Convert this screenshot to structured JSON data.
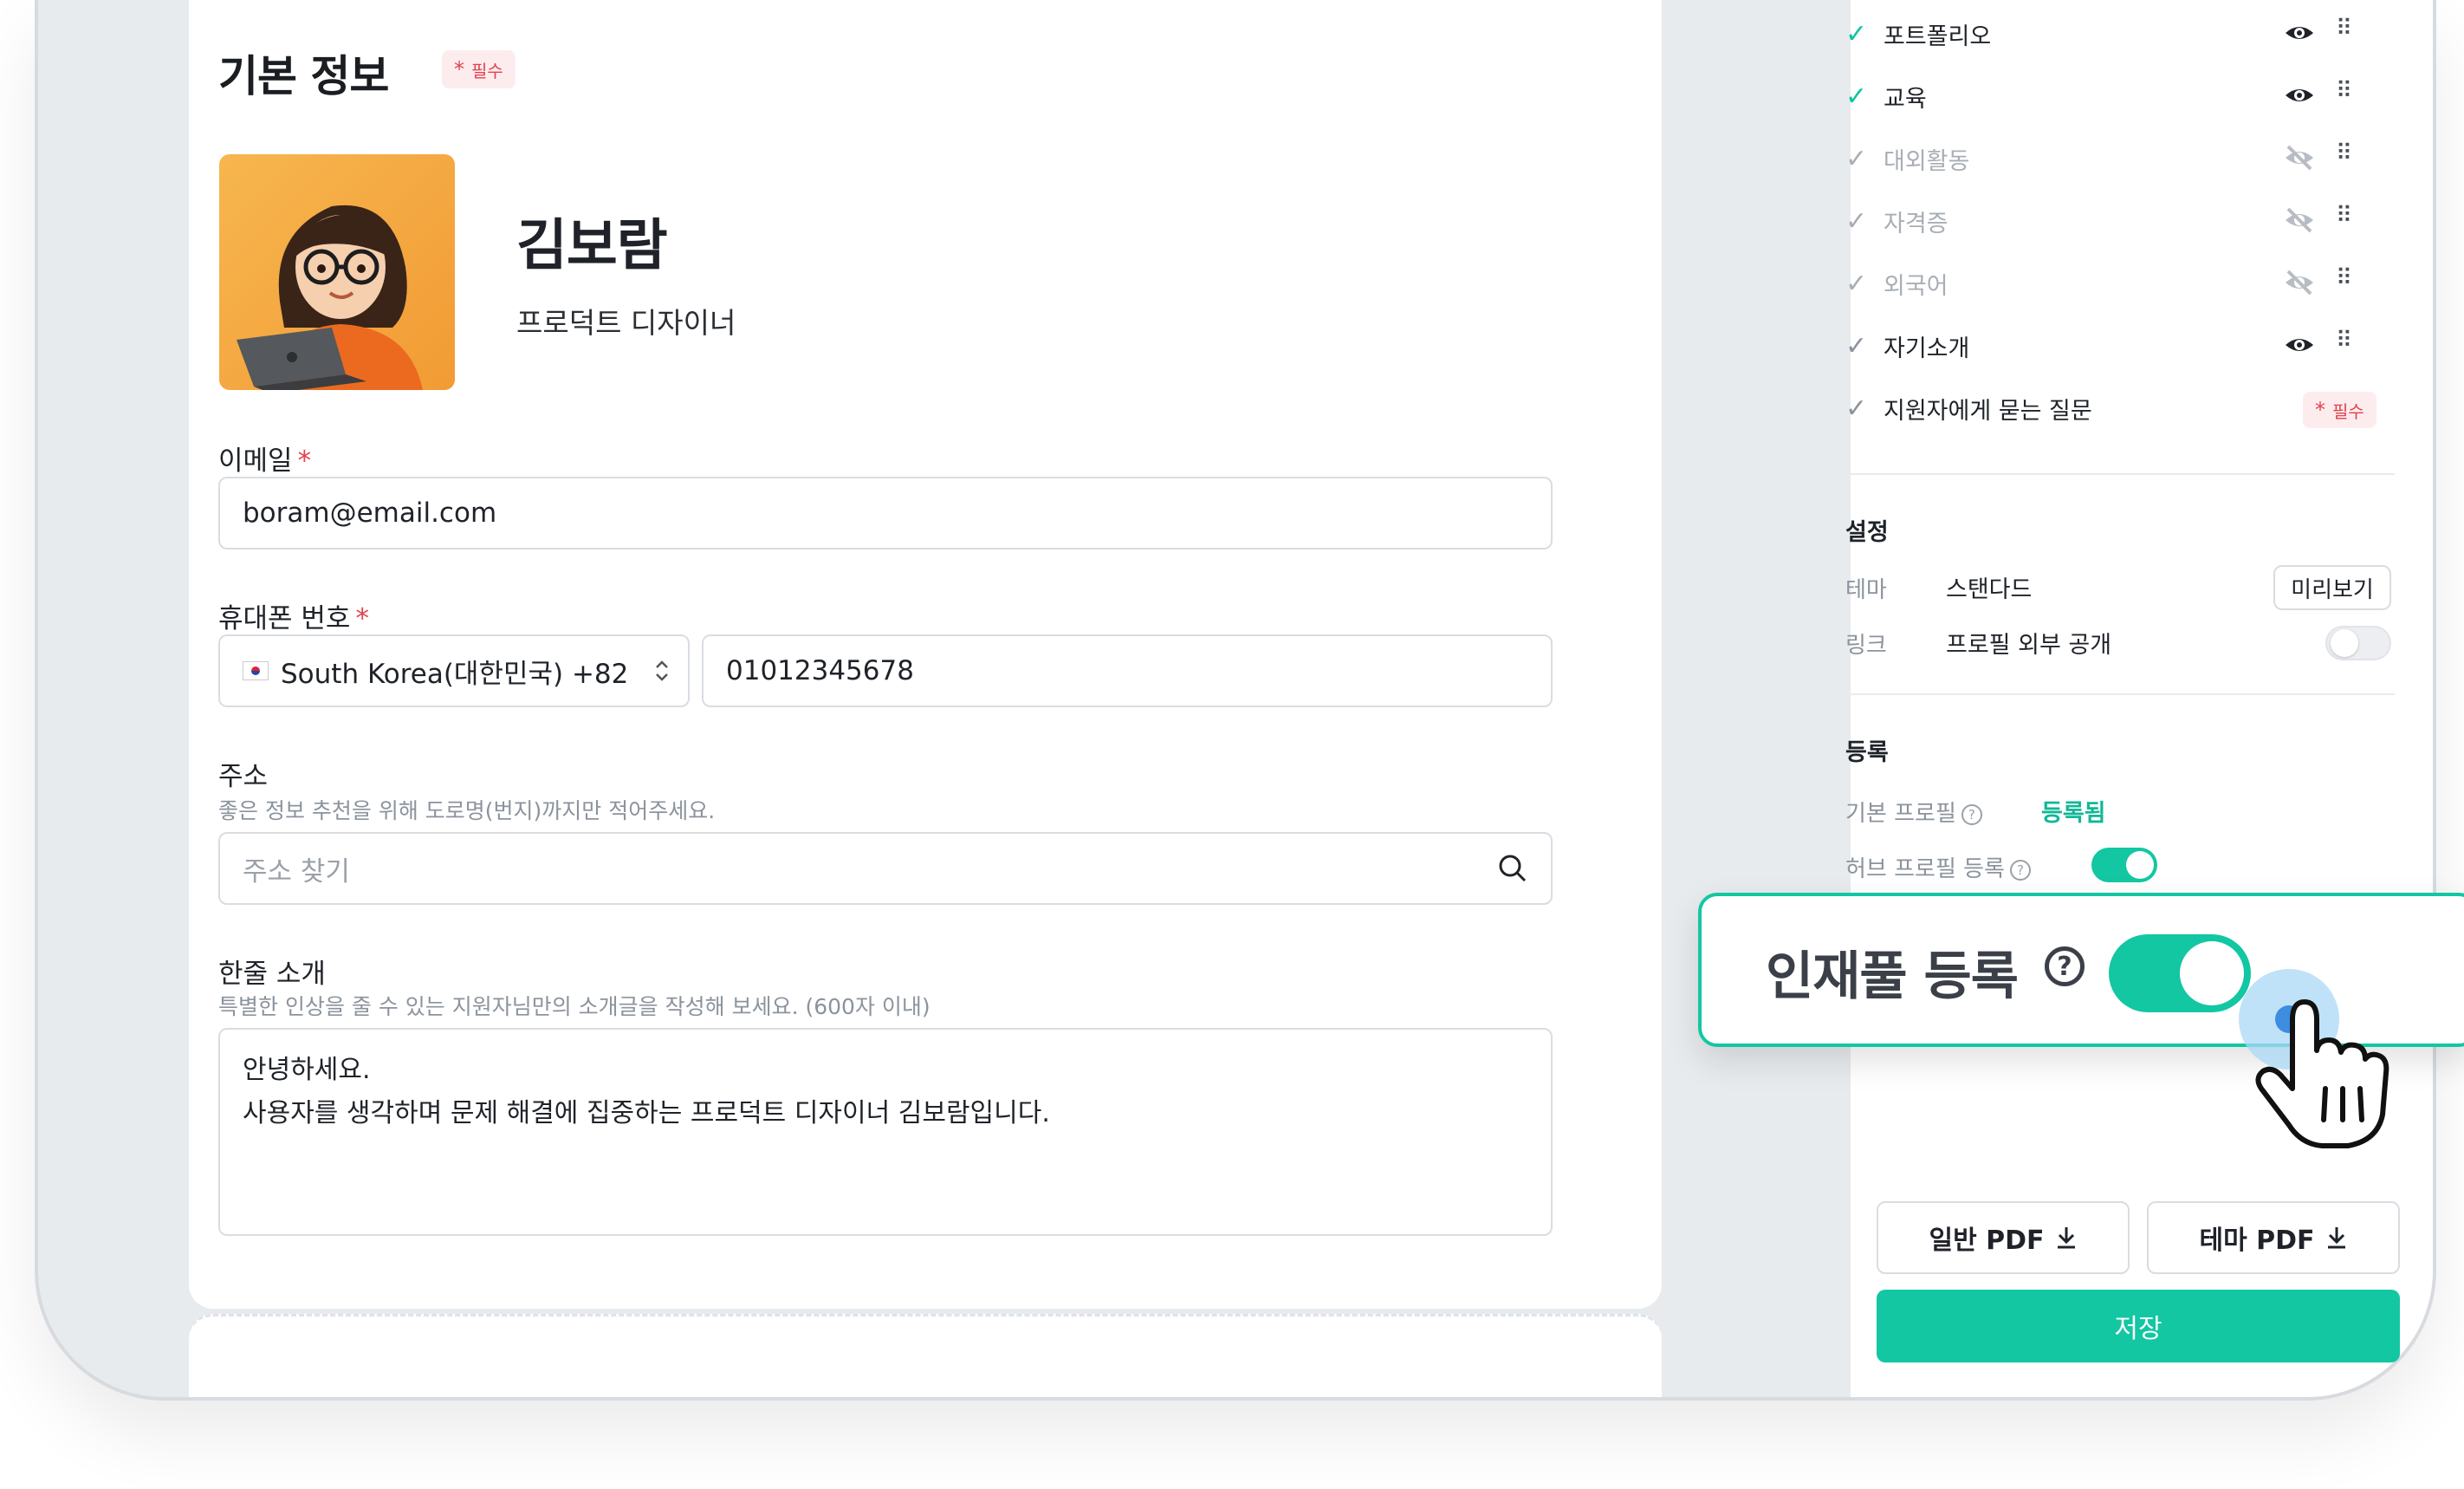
{
  "basic_info": {
    "title": "기본 정보",
    "required_badge": "필수",
    "required_star": "*"
  },
  "profile": {
    "name": "김보람",
    "role": "프로덕트 디자이너"
  },
  "form": {
    "email": {
      "label": "이메일",
      "value": "boram@email.com"
    },
    "phone": {
      "label": "휴대폰 번호",
      "country": "South Korea(대한민국) +82",
      "value": "01012345678"
    },
    "address": {
      "label": "주소",
      "hint": "좋은 정보 추천을 위해 도로명(번지)까지만 적어주세요.",
      "placeholder": "주소 찾기"
    },
    "intro": {
      "label": "한줄 소개",
      "hint": "특별한 인상을 줄 수 있는 지원자님만의 소개글을 작성해 보세요. (600자 이내)",
      "line1": "안녕하세요.",
      "line2": "사용자를 생각하며 문제 해결에 집중하는 프로덕트 디자이너 김보람입니다."
    }
  },
  "sections": [
    {
      "label": "포트폴리오",
      "checked": true,
      "visible": true
    },
    {
      "label": "교육",
      "checked": true,
      "visible": true
    },
    {
      "label": "대외활동",
      "checked": false,
      "visible": false
    },
    {
      "label": "자격증",
      "checked": false,
      "visible": false
    },
    {
      "label": "외국어",
      "checked": false,
      "visible": false
    },
    {
      "label": "자기소개",
      "checked": true,
      "visible": true
    },
    {
      "label": "지원자에게 묻는 질문",
      "checked": true,
      "required": "필수"
    }
  ],
  "settings": {
    "title": "설정",
    "theme_key": "테마",
    "theme_value": "스탠다드",
    "preview_button": "미리보기",
    "link_key": "링크",
    "link_value": "프로필 외부 공개",
    "link_toggle_on": false
  },
  "registration": {
    "title": "등록",
    "basic_key": "기본 프로필",
    "basic_status": "등록됨",
    "hub_key": "허브 프로필 등록",
    "hub_toggle_on": true,
    "help_glyph": "?"
  },
  "popup": {
    "label": "인재풀 등록",
    "help_glyph": "?",
    "toggle_on": true
  },
  "actions": {
    "pdf_general": "일반 PDF",
    "pdf_theme": "테마 PDF",
    "save": "저장"
  },
  "colors": {
    "accent": "#12c7a2",
    "required": "#e0434f",
    "badge_bg": "#fdecee"
  }
}
